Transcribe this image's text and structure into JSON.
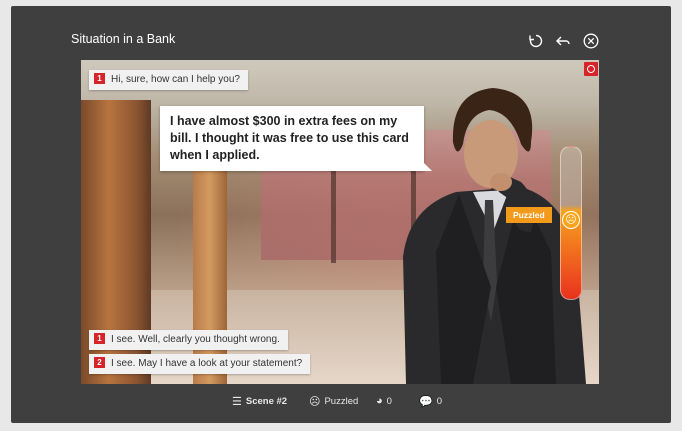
{
  "title": "Situation in a Bank",
  "toolbar": {
    "restart_icon": "restart-icon",
    "back_icon": "back-arrow-icon",
    "close_icon": "close-icon"
  },
  "conversation": {
    "previous_prompt": {
      "number": "1",
      "text": "Hi, sure, how can I help you?"
    },
    "speaker_line": "I have almost $300 in extra fees on my bill. I thought it was free to use this card when I applied.",
    "options": [
      {
        "number": "1",
        "text": "I see. Well, clearly you thought wrong."
      },
      {
        "number": "2",
        "text": "I see. May I have a look at your statement?"
      }
    ]
  },
  "mood": {
    "label": "Puzzled",
    "level": 0.45,
    "icon": "puzzled-face-icon"
  },
  "status_bar": {
    "scene": "Scene #2",
    "mood": "Puzzled",
    "score": "0",
    "messages": "0"
  },
  "colors": {
    "accent": "#d7232a",
    "mood": "#f39a1b",
    "window": "#3f3f3f"
  }
}
